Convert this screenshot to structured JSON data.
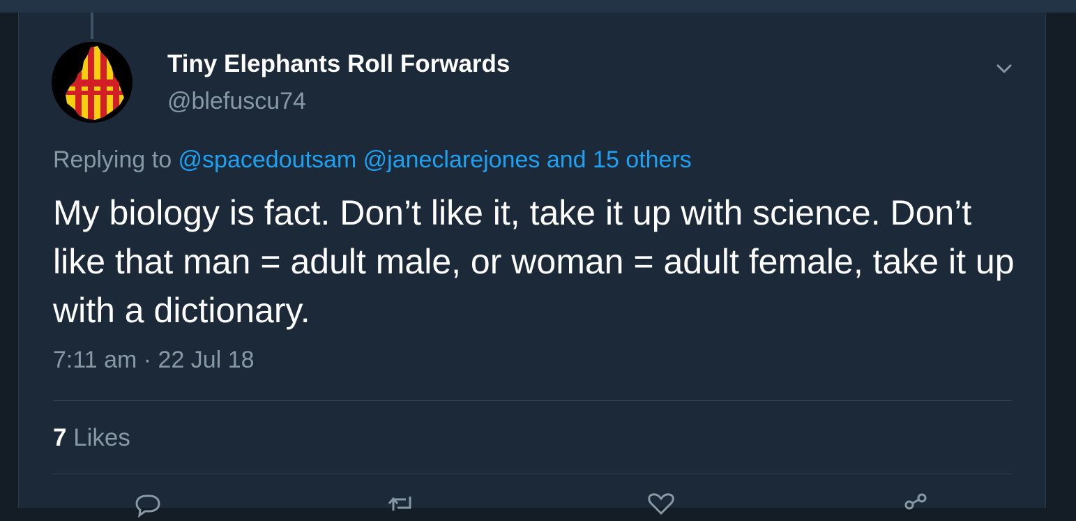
{
  "tweet": {
    "display_name": "Tiny Elephants Roll Forwards",
    "handle": "@blefuscu74",
    "replying_prefix": "Replying to ",
    "reply_targets": "@spacedoutsam @janeclarejones and 15 others",
    "text": "My biology is fact. Don’t like it, take it up with science. Don’t like that man = adult male, or woman = adult female, take it up with a dictionary.",
    "timestamp": "7:11 am · 22 Jul 18",
    "likes_count": "7",
    "likes_label": " Likes"
  },
  "icons": {
    "more": "chevron-down-icon",
    "reply": "reply-icon",
    "retweet": "retweet-icon",
    "like": "heart-icon",
    "share": "share-icon"
  },
  "colors": {
    "background": "#1c2938",
    "accent": "#1da1f2",
    "secondary_text": "#8899a6",
    "avatar_red": "#d21f26",
    "avatar_yellow": "#f5d010"
  }
}
